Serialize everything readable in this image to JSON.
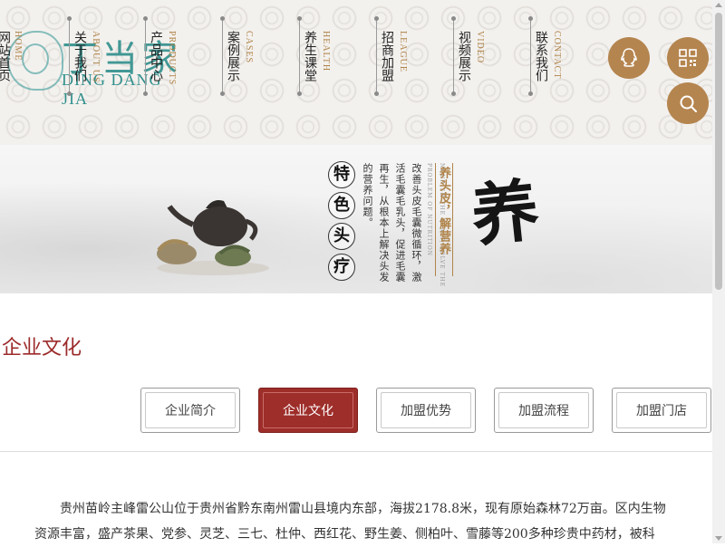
{
  "header": {
    "logo": {
      "text_cn": "丁当家",
      "text_en": "DING DANG JIA"
    },
    "nav": [
      {
        "cn": "网站首页",
        "en": "HOME"
      },
      {
        "cn": "关于我们",
        "en": "ABOUT US"
      },
      {
        "cn": "产品中心",
        "en": "PRODUCTS"
      },
      {
        "cn": "案例展示",
        "en": "CASES"
      },
      {
        "cn": "养生课堂",
        "en": "HEALTH"
      },
      {
        "cn": "招商加盟",
        "en": "LEAGUE"
      },
      {
        "cn": "视频展示",
        "en": "VIDEO"
      },
      {
        "cn": "联系我们",
        "en": "CONTACT"
      }
    ],
    "buttons": {
      "qq_icon": "qq-icon",
      "qr_icon": "qr-code-icon",
      "search_icon": "search-icon"
    }
  },
  "banner": {
    "chars": [
      "特",
      "色",
      "头",
      "疗"
    ],
    "desc_col1": "改善头皮毛囊微循环，激",
    "desc_col2": "活毛囊毛乳头，促进毛囊",
    "desc_col3": "再生，从根本上解决头发",
    "desc_col4": "的营养问题。",
    "subtitle_cn": "养头皮，解营养",
    "subtitle_en": "NOURISH THE SCALP, SOLVE THE PROBLEM OF NUTRITION",
    "big_char": "养"
  },
  "section": {
    "title": "企业文化"
  },
  "tabs": [
    {
      "label": "企业简介",
      "active": false
    },
    {
      "label": "企业文化",
      "active": true
    },
    {
      "label": "加盟优势",
      "active": false
    },
    {
      "label": "加盟流程",
      "active": false
    },
    {
      "label": "加盟门店",
      "active": false
    }
  ],
  "content": {
    "paragraph": "贵州苗岭主峰雷公山位于贵州省黔东南州雷山县境内东部，海拔2178.8米，现有原始森林72万亩。区内生物资源丰富，盛产茶果、党参、灵芝、三七、杜仲、西红花、野生姜、侧柏叶、雪藤等200多种珍贵中药材，被科"
  },
  "colors": {
    "accent": "#9e2e2a",
    "gold": "#b5854f",
    "teal": "#2f8f8c"
  }
}
